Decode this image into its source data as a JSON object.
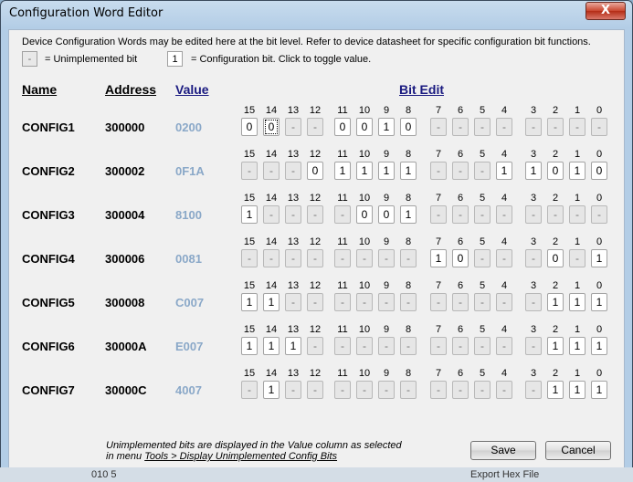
{
  "window": {
    "title": "Configuration Word Editor",
    "close_label": "X"
  },
  "info": {
    "line1": "Device Configuration Words may be edited here at the bit level.  Refer to device datasheet for specific configuration bit functions.",
    "unimp_symbol": "-",
    "unimp_text": "= Unimplemented bit",
    "cfg_symbol": "1",
    "cfg_text": "= Configuration bit.  Click to toggle value."
  },
  "headers": {
    "name": "Name",
    "address": "Address",
    "value": "Value",
    "bit_edit": "Bit Edit"
  },
  "bit_numbers": [
    "15",
    "14",
    "13",
    "12",
    "11",
    "10",
    "9",
    "8",
    "7",
    "6",
    "5",
    "4",
    "3",
    "2",
    "1",
    "0"
  ],
  "registers": [
    {
      "name": "CONFIG1",
      "address": "300000",
      "value": "0200",
      "bits": [
        "0",
        "0",
        "-",
        "-",
        "0",
        "0",
        "1",
        "0",
        "-",
        "-",
        "-",
        "-",
        "-",
        "-",
        "-",
        "-"
      ]
    },
    {
      "name": "CONFIG2",
      "address": "300002",
      "value": "0F1A",
      "bits": [
        "-",
        "-",
        "-",
        "0",
        "1",
        "1",
        "1",
        "1",
        "-",
        "-",
        "-",
        "1",
        "1",
        "0",
        "1",
        "0"
      ]
    },
    {
      "name": "CONFIG3",
      "address": "300004",
      "value": "8100",
      "bits": [
        "1",
        "-",
        "-",
        "-",
        "-",
        "0",
        "0",
        "1",
        "-",
        "-",
        "-",
        "-",
        "-",
        "-",
        "-",
        "-"
      ]
    },
    {
      "name": "CONFIG4",
      "address": "300006",
      "value": "0081",
      "bits": [
        "-",
        "-",
        "-",
        "-",
        "-",
        "-",
        "-",
        "-",
        "1",
        "0",
        "-",
        "-",
        "-",
        "0",
        "-",
        "1"
      ]
    },
    {
      "name": "CONFIG5",
      "address": "300008",
      "value": "C007",
      "bits": [
        "1",
        "1",
        "-",
        "-",
        "-",
        "-",
        "-",
        "-",
        "-",
        "-",
        "-",
        "-",
        "-",
        "1",
        "1",
        "1"
      ]
    },
    {
      "name": "CONFIG6",
      "address": "30000A",
      "value": "E007",
      "bits": [
        "1",
        "1",
        "1",
        "-",
        "-",
        "-",
        "-",
        "-",
        "-",
        "-",
        "-",
        "-",
        "-",
        "1",
        "1",
        "1"
      ]
    },
    {
      "name": "CONFIG7",
      "address": "30000C",
      "value": "4007",
      "bits": [
        "-",
        "1",
        "-",
        "-",
        "-",
        "-",
        "-",
        "-",
        "-",
        "-",
        "-",
        "-",
        "-",
        "1",
        "1",
        "1"
      ]
    }
  ],
  "footnote": {
    "line1": "Unimplemented bits are displayed in the Value column as selected",
    "line2_prefix": "in menu  ",
    "line2_link": "Tools > Display Unimplemented Config Bits"
  },
  "buttons": {
    "save": "Save",
    "cancel": "Cancel"
  },
  "background": {
    "left_text": "010   5",
    "right_text": "Export Hex File"
  }
}
